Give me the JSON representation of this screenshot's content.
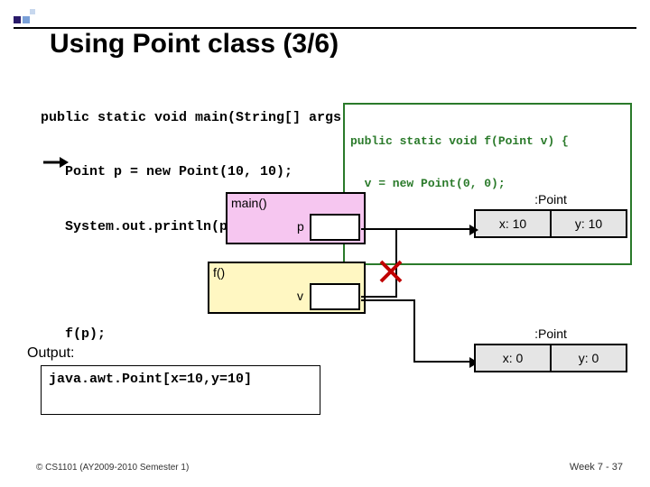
{
  "title": "Using Point class (3/6)",
  "code_main": {
    "l1": "public static void main(String[] args) {",
    "l2": "   Point p = new Point(10, 10);",
    "l3": "   System.out.println(p);",
    "l4": "   f(p);"
  },
  "code_callout": {
    "l1": "public static void f(Point v) {",
    "l2": "  v = new Point(0, 0);",
    "l3": "}"
  },
  "frame_main": {
    "label": "main()",
    "var": "p"
  },
  "frame_f": {
    "label": "f()",
    "var": "v"
  },
  "point1": {
    "header": ":Point",
    "x_label": "x: 10",
    "y_label": "y: 10"
  },
  "point2": {
    "header": ":Point",
    "x_label": "x: 0",
    "y_label": "y: 0"
  },
  "output_label": "Output:",
  "output_text": "java.awt.Point[x=10,y=10]",
  "footer_left": "© CS1101 (AY2009-2010 Semester 1)",
  "footer_right": "Week 7 - 37",
  "colors": {
    "deco_purple": "#2a1a6a",
    "deco_blue": "#7aa0d8",
    "callout_green": "#2a7a2a",
    "main_pink": "#f6c6f0",
    "f_yellow": "#fff7c2",
    "obj_grey": "#e5e5e5",
    "cross_red": "#c00000"
  }
}
